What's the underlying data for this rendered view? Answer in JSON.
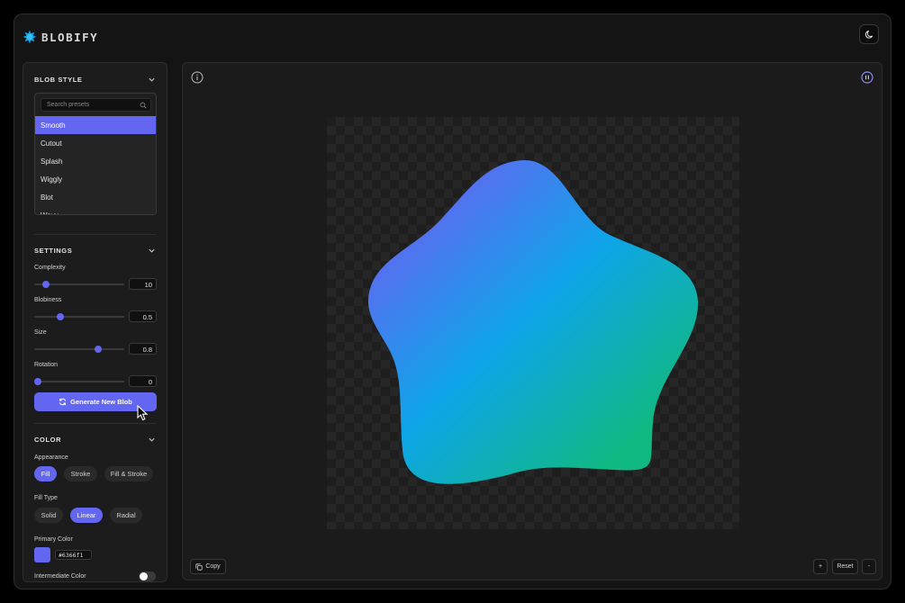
{
  "app": {
    "name": "BLOBIFY"
  },
  "sidebar": {
    "blob_style": {
      "title": "BLOB STYLE",
      "search_placeholder": "Search presets",
      "presets": [
        "Smooth",
        "Cutout",
        "Splash",
        "Wiggly",
        "Blot",
        "Wavy"
      ],
      "selected": "Smooth"
    },
    "settings": {
      "title": "SETTINGS",
      "complexity": {
        "label": "Complexity",
        "value": "10",
        "fraction": 0.1
      },
      "blobiness": {
        "label": "Blobiness",
        "value": "0.5",
        "fraction": 0.27
      },
      "size": {
        "label": "Size",
        "value": "0.8",
        "fraction": 0.73
      },
      "rotation": {
        "label": "Rotation",
        "value": "0",
        "fraction": 0.0
      },
      "generate_label": "Generate New Blob"
    },
    "color": {
      "title": "COLOR",
      "appearance_label": "Appearance",
      "appearance_options": [
        "Fill",
        "Stroke",
        "Fill & Stroke"
      ],
      "appearance_selected": "Fill",
      "fill_type_label": "Fill Type",
      "fill_type_options": [
        "Solid",
        "Linear",
        "Radial"
      ],
      "fill_type_selected": "Linear",
      "primary_label": "Primary Color",
      "primary_hex": "#6366f1",
      "intermediate_label": "Intermediate Color",
      "intermediate_enabled": false
    }
  },
  "canvas": {
    "copy_label": "Copy",
    "zoom_in_label": "+",
    "reset_label": "Reset",
    "zoom_out_label": "-",
    "gradient_colors": [
      "#6366f1",
      "#0ea5e9",
      "#10b981"
    ]
  }
}
